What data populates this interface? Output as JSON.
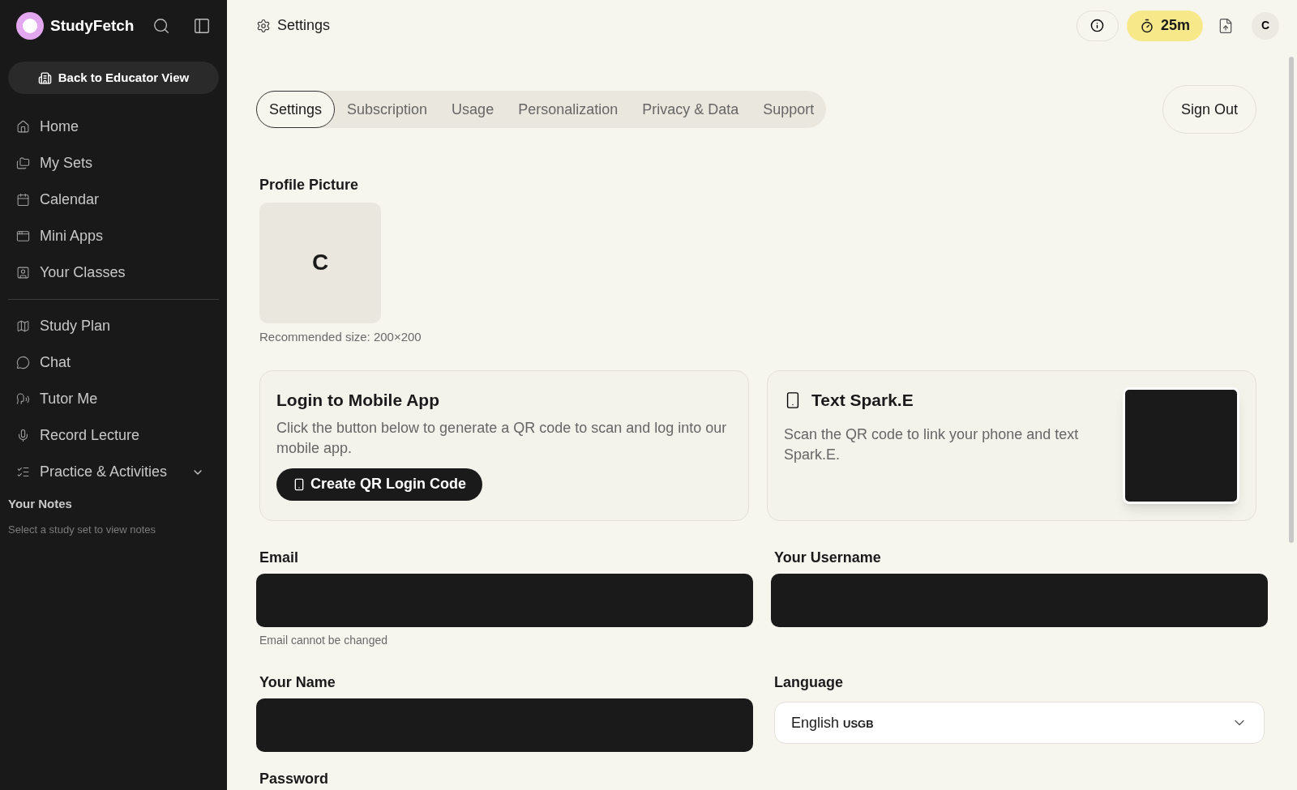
{
  "sidebar": {
    "brand": "StudyFetch",
    "educator_button": "Back to Educator View",
    "items": [
      {
        "label": "Home"
      },
      {
        "label": "My Sets"
      },
      {
        "label": "Calendar"
      },
      {
        "label": "Mini Apps"
      },
      {
        "label": "Your Classes"
      }
    ],
    "items_2": [
      {
        "label": "Study Plan",
        "kind": "link"
      },
      {
        "label": "Chat",
        "kind": "link"
      },
      {
        "label": "Tutor Me",
        "kind": "link"
      },
      {
        "label": "Record Lecture",
        "kind": "link"
      },
      {
        "label": "Practice & Activities",
        "kind": "group"
      }
    ],
    "notes_title": "Your Notes",
    "notes_hint": "Select a study set to view notes"
  },
  "header": {
    "title": "Settings",
    "timer": "25m",
    "avatar": "C"
  },
  "tabs": [
    {
      "label": "Settings",
      "selected": true
    },
    {
      "label": "Subscription",
      "selected": false
    },
    {
      "label": "Usage",
      "selected": false
    },
    {
      "label": "Personalization",
      "selected": false
    },
    {
      "label": "Privacy & Data",
      "selected": false
    },
    {
      "label": "Support",
      "selected": false
    }
  ],
  "sign_out": "Sign Out",
  "profile": {
    "label": "Profile Picture",
    "initial": "C",
    "hint": "Recommended size: 200×200"
  },
  "mobile_card": {
    "title": "Login to Mobile App",
    "text": "Click the button below to generate a QR code to scan and log into our mobile app.",
    "button": "Create QR Login Code"
  },
  "spark_card": {
    "title": "Text Spark.E",
    "text": "Scan the QR code to link your phone and text Spark.E."
  },
  "fields": [
    {
      "label": "Email",
      "hint": "Email cannot be changed"
    },
    {
      "label": "Your Username"
    },
    {
      "label": "Your Name"
    }
  ],
  "language": {
    "label": "Language",
    "value": "English",
    "suffix": "USGB"
  },
  "password_label": "Password"
}
